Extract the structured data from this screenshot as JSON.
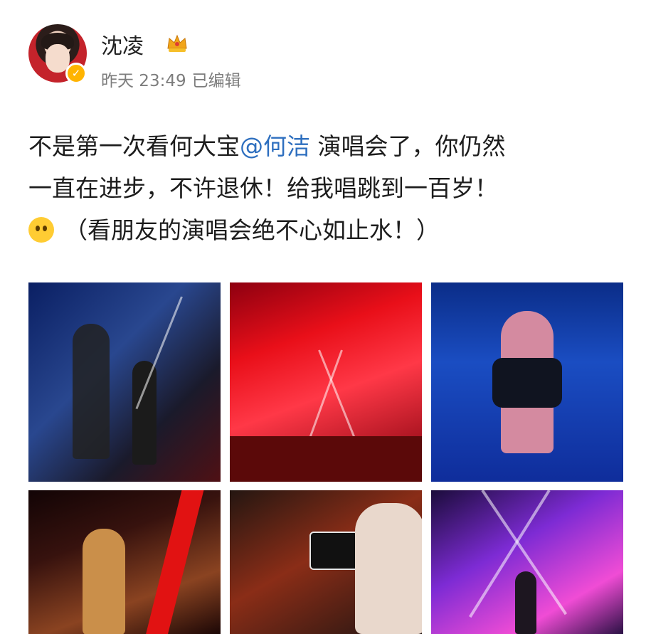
{
  "user": {
    "name": "沈凌",
    "time": "昨天 23:49",
    "edited": "已编辑"
  },
  "post": {
    "line1_before": "不是第一次看何大宝",
    "mention": "@何洁",
    "line1_after": " 演唱会了，你仍然",
    "line2": "一直在进步，不许退休！给我唱跳到一百岁！",
    "line3": "（看朋友的演唱会绝不心如止水！）"
  },
  "photos": [
    {
      "description": "concert-stage-blue"
    },
    {
      "description": "concert-stage-red"
    },
    {
      "description": "singer-closeup-blue"
    },
    {
      "description": "singer-performance"
    },
    {
      "description": "audience-phone"
    },
    {
      "description": "stage-lights-purple"
    }
  ],
  "icons": {
    "crown": "crown-icon",
    "verified": "verified-badge-icon",
    "emoji": "smiling-emoji-icon"
  },
  "colors": {
    "mention": "#2e6fbf",
    "meta": "#7d7d7d"
  }
}
